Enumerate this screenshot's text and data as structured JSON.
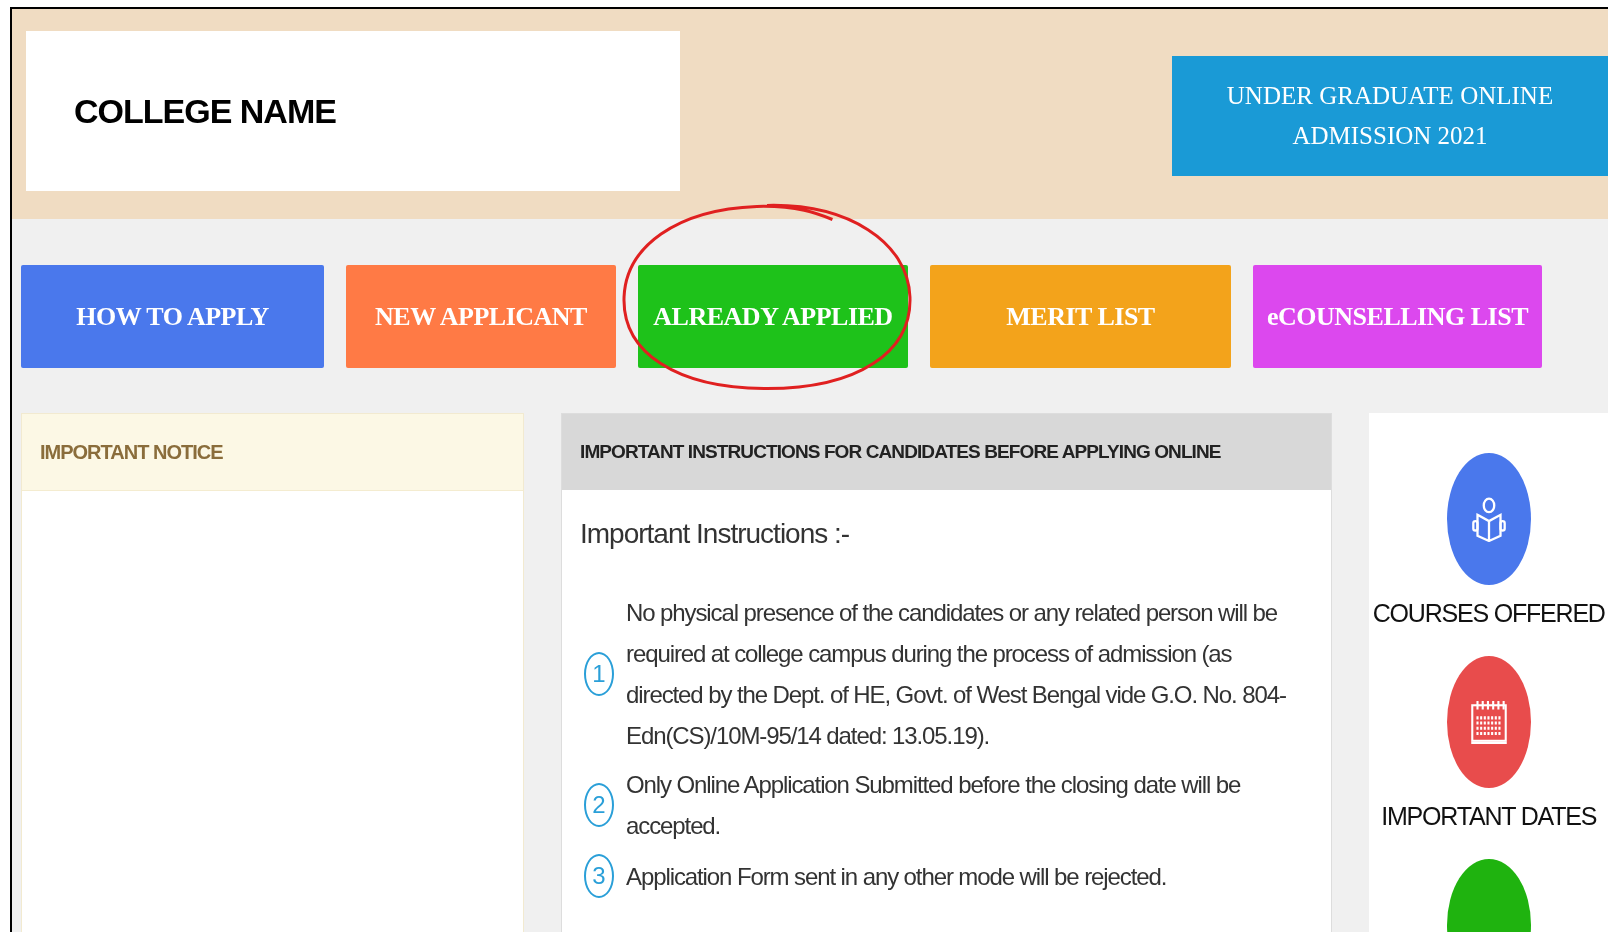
{
  "header": {
    "college_name": "COLLEGE NAME",
    "banner": "UNDER GRADUATE ONLINE ADMISSION 2021"
  },
  "nav_buttons": [
    {
      "label": "HOW TO APPLY",
      "color": "#4a78ec",
      "circled": false
    },
    {
      "label": "NEW APPLICANT",
      "color": "#ff7a45",
      "circled": false
    },
    {
      "label": "ALREADY APPLIED",
      "color": "#1ec21a",
      "circled": true
    },
    {
      "label": "MERIT LIST",
      "color": "#f3a31b",
      "circled": false
    },
    {
      "label": "eCOUNSELLING LIST",
      "color": "#dc48ee",
      "circled": false
    }
  ],
  "notice_panel": {
    "title": "IMPORTANT NOTICE"
  },
  "instructions_panel": {
    "title": "IMPORTANT INSTRUCTIONS FOR CANDIDATES BEFORE APPLYING ONLINE",
    "heading": "Important Instructions :-",
    "items": [
      {
        "number": "1",
        "text": "No physical presence of the candidates or any related person will be required at college campus during the process of admission (as directed by the Dept. of HE, Govt. of West Bengal vide G.O. No. 804-Edn(CS)/10M-95/14 dated: 13.05.19)."
      },
      {
        "number": "2",
        "text": "Only Online Application Submitted before the closing date will be accepted."
      },
      {
        "number": "3",
        "text": "Application Form sent in any other mode will be rejected."
      }
    ]
  },
  "quick_links": [
    {
      "kind": "reader",
      "label": "COURSES OFFERED",
      "color": "#4a78ec"
    },
    {
      "kind": "calendar",
      "label": "IMPORTANT DATES",
      "color": "#e84c4c"
    },
    {
      "kind": "blank",
      "color": "#1fb30f"
    }
  ]
}
